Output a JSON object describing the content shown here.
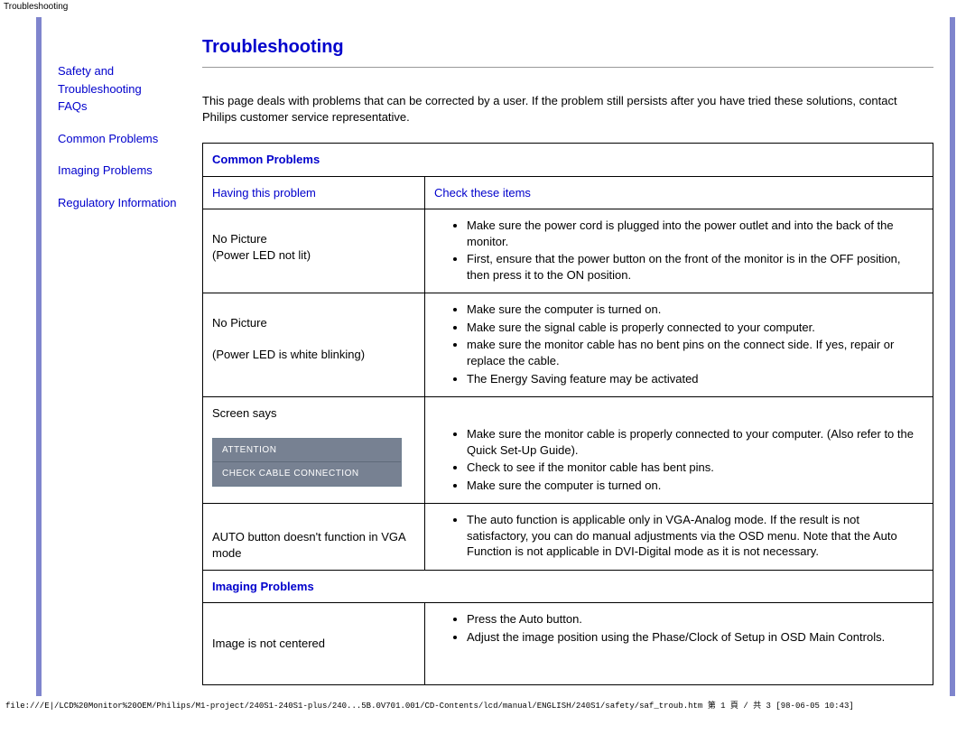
{
  "doc_title": "Troubleshooting",
  "sidebar": {
    "links": [
      "Safety and Troubleshooting",
      "FAQs",
      "Common Problems",
      "Imaging Problems",
      "Regulatory Information"
    ]
  },
  "heading": "Troubleshooting",
  "intro": "This page deals with problems that can be corrected by a user. If the problem still persists after you have tried these solutions, contact Philips customer service representative.",
  "sections": {
    "common_problems": {
      "title": "Common Problems",
      "col_left": "Having this problem",
      "col_right": "Check these items",
      "rows": [
        {
          "problem_line1": "No Picture",
          "problem_line2": "(Power LED not lit)",
          "checks": [
            "Make sure the power cord is plugged into the power outlet and into the back of the monitor.",
            "First, ensure that the power button on the front of the monitor is in the OFF position, then press it to the ON position."
          ]
        },
        {
          "problem_line1": "No Picture",
          "problem_line2": "(Power LED is white blinking)",
          "checks": [
            "Make sure the computer is turned on.",
            "Make sure the signal cable is properly connected to your computer.",
            "make sure the monitor cable has no bent pins on the connect side. If yes, repair or replace the cable.",
            "The Energy Saving feature may be activated"
          ]
        },
        {
          "problem_line1": "Screen says",
          "attention": {
            "line1": "ATTENTION",
            "line2": "CHECK CABLE CONNECTION"
          },
          "checks": [
            "Make sure the monitor cable is properly connected to your computer. (Also refer to the Quick Set-Up Guide).",
            "Check to see if the monitor cable has bent pins.",
            "Make sure the computer is turned on."
          ]
        },
        {
          "problem_line1": "AUTO button doesn't function in VGA mode",
          "checks": [
            "The auto function is applicable only in VGA-Analog mode.  If the result is not satisfactory, you can do manual adjustments via the OSD menu.  Note that the Auto Function is not applicable in DVI-Digital mode as it is not necessary."
          ]
        }
      ]
    },
    "imaging_problems": {
      "title": "Imaging Problems",
      "rows": [
        {
          "problem_line1": "Image is not centered",
          "checks": [
            "Press the Auto button.",
            "Adjust the image position using the Phase/Clock of Setup in OSD Main Controls."
          ]
        }
      ]
    }
  },
  "footer": "file:///E|/LCD%20Monitor%20OEM/Philips/M1-project/240S1-240S1-plus/240...5B.0V701.001/CD-Contents/lcd/manual/ENGLISH/240S1/safety/saf_troub.htm 第 1 頁 / 共 3  [98-06-05 10:43]"
}
